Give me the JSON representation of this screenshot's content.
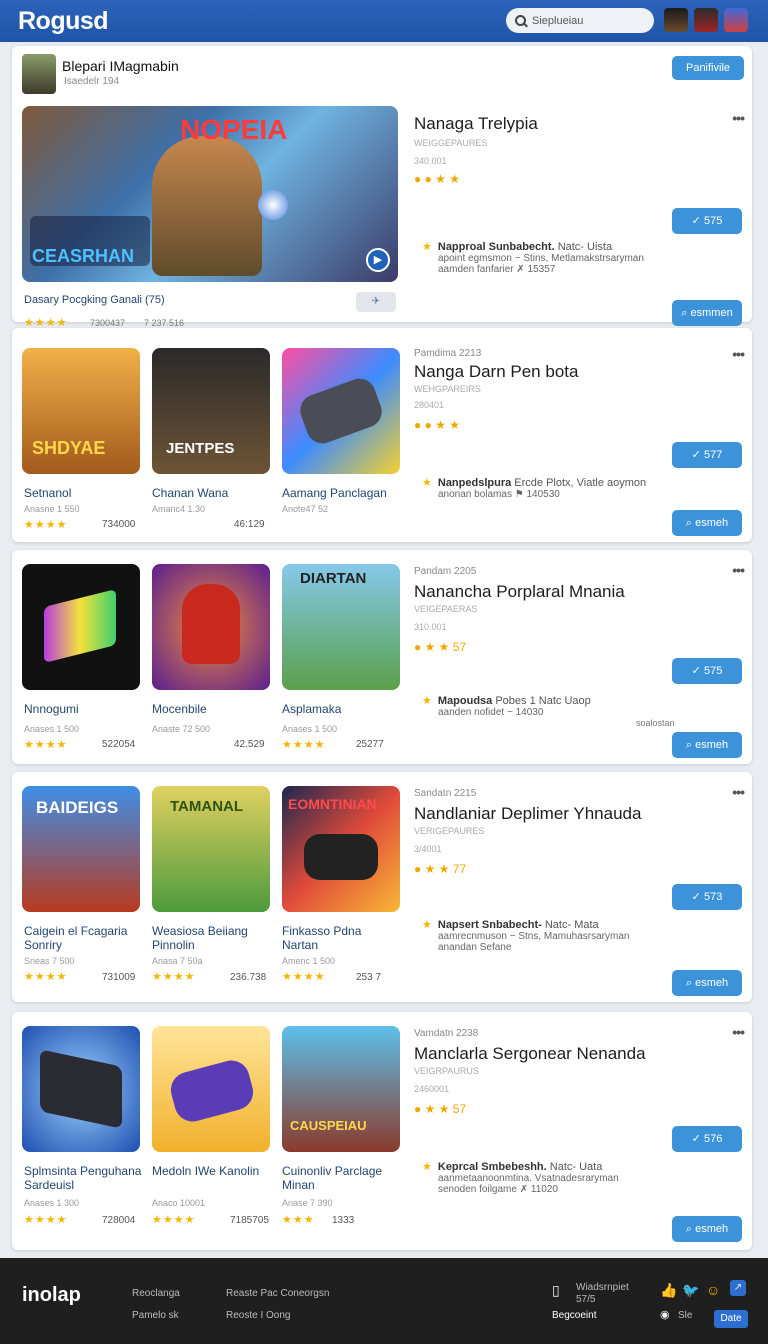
{
  "header": {
    "brand": "Rogusd",
    "search_placeholder": "Sieplueiau"
  },
  "profile": {
    "title": "Blepari IMagmabin",
    "subtitle": "Isaedelr 194",
    "follow_label": "Panifivile"
  },
  "featured": {
    "banner_title": "NOPEIA",
    "banner_sub": "CEASRHAN",
    "caption": "Dasary Pocgking Ganali (75)",
    "count1": "7300437",
    "count2": "7 237.516",
    "side_kicker": "",
    "side_title": "Nanaga Trelypia",
    "side_sub": "WEIGGEPAURES",
    "side_num": "340.001",
    "btn1": "575",
    "review_name": "Napproal Sunbabecht.",
    "review_tag": "Natc- Uista",
    "review_l2": "apoint egmsmon − Stins, Metlamakstrsaryman",
    "review_l3": "aamden fanfarier ✗ 15357",
    "btn2": "esmmen"
  },
  "sections": [
    {
      "side_kicker": "Pamdima 2213",
      "side_title": "Nanga Darn Pen bota",
      "side_sub": "WEHGPAREIRS",
      "side_num": "280401",
      "btn1": "577",
      "review_name": "Nanpedslpura",
      "review_tag": "Ercde Plotx, Viatle aoymon",
      "review_l2": "anonan bolamas ⚑ 140530",
      "btn2": "esmeh",
      "tiles": [
        {
          "name": "Setnanol",
          "meta": "Anasne 1 550",
          "count": "734000",
          "poster": "SHDYAE"
        },
        {
          "name": "Chanan Wana",
          "meta": "Amanc4 1.30",
          "count": "46:129",
          "poster": "JENTPES"
        },
        {
          "name": "Aamang Panclagan",
          "meta": "Anote47 52",
          "count": "",
          "poster": ""
        }
      ]
    },
    {
      "side_kicker": "Pandam 2205",
      "side_title": "Nanancha Porplaral Mnania",
      "side_sub": "VEIGEPAERAS",
      "side_num": "310.001",
      "btn1": "575",
      "review_name": "Mapoudsa",
      "review_tag": "Pobes 1 Natc Uaop",
      "review_l2": "aanden nofidet − 14030",
      "note": "soalostan",
      "btn2": "esmeh",
      "tiles": [
        {
          "name": "Nnnogumi",
          "meta": "Anases 1 500",
          "count": "522054",
          "poster": ""
        },
        {
          "name": "Mocenbile",
          "meta": "Anaste 72 500",
          "count": "42.529",
          "poster": ""
        },
        {
          "name": "Asplamaka",
          "meta": "Anases 1 500",
          "count": "25277",
          "poster": "DIARTAN"
        }
      ]
    },
    {
      "side_kicker": "Sandatn 2215",
      "side_title": "Nandlaniar Deplimer Yhnauda",
      "side_sub": "VERIGEPAURES",
      "side_num": "3/4001",
      "btn1": "573",
      "review_name": "Napsert Snbabecht-",
      "review_tag": "Natc- Mata",
      "review_l2": "aamrecnmuson − Stns, Mamuhasrsaryman",
      "review_l3": "anandan Sefane",
      "btn2": "esmeh",
      "tiles": [
        {
          "name": "Caigein el Fcagaria Sonriry",
          "meta": "Sneas 7 500",
          "count": "731009",
          "poster": "BAIDEIGS"
        },
        {
          "name": "Weasiosa Beiiang Pinnolin",
          "meta": "Anasa 7 50a",
          "count": "236.738",
          "poster": "TAMANAL"
        },
        {
          "name": "Finkasso Pdna Nartan",
          "meta": "Amenc 1 500",
          "count": "253 7",
          "poster": "EOMNTINIAN"
        }
      ]
    },
    {
      "side_kicker": "Vamdatn 2238",
      "side_title": "Manclarla Sergonear Nenanda",
      "side_sub": "VEIGRPAURUS",
      "side_num": "2460001",
      "btn1": "576",
      "review_name": "Keprcal Smbebeshh.",
      "review_tag": "Natc- Uata",
      "review_l2": "aanmetaanoonmtina. Vsatnadesraryman",
      "review_l3": "senoden foilgame ✗ 11020",
      "btn2": "esmeh",
      "tiles": [
        {
          "name": "Splmsinta Penguhana Sardeuisl",
          "meta": "Anases 1 300",
          "count": "728004",
          "poster": ""
        },
        {
          "name": "Medoln IWe Kanolin",
          "meta": "Anaco 10001",
          "count": "7185705",
          "poster": ""
        },
        {
          "name": "Cuinonliv Parclage Minan",
          "meta": "Anase 7 390",
          "count": "1333",
          "poster": "CAUSPEIAU"
        }
      ]
    }
  ],
  "footer": {
    "logo": "inolap",
    "links": [
      "Reoclanga",
      "Pamelo sk",
      "Reaste Pac Coneorgsn",
      "Reoste I Oong"
    ],
    "right_text": "Wiadsrnpiet",
    "right_sub": "57/5",
    "bottom_label": "Begcoeint",
    "lang": "Sle",
    "badge": "Date"
  }
}
